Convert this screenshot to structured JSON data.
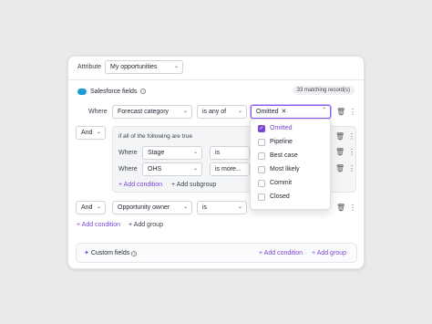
{
  "attribute": {
    "label": "Attribute",
    "value": "My opportunities"
  },
  "salesforce": {
    "title": "Salesforce fields",
    "matching": "33 matching record(s)"
  },
  "row1": {
    "where": "Where",
    "field": "Forecast category",
    "operator": "is any of",
    "chip": "Omitted"
  },
  "group": {
    "joiner": "And",
    "heading": "if all of the following are true",
    "rows": [
      {
        "where": "Where",
        "field": "Stage",
        "operator": "is"
      },
      {
        "where": "Where",
        "field": "OHS",
        "operator": "is more..."
      }
    ],
    "add_condition": "Add condition",
    "add_subgroup": "Add subgroup"
  },
  "row3": {
    "joiner": "And",
    "field": "Opportunity owner",
    "operator": "is"
  },
  "actions": {
    "add_condition": "Add condition",
    "add_group": "Add group"
  },
  "custom": {
    "title": "Custom fields",
    "add_condition": "Add condition",
    "add_group": "Add group"
  },
  "dropdown": {
    "options": [
      {
        "label": "Omitted",
        "checked": true
      },
      {
        "label": "Pipeline",
        "checked": false
      },
      {
        "label": "Best case",
        "checked": false
      },
      {
        "label": "Most likely",
        "checked": false
      },
      {
        "label": "Commit",
        "checked": false
      },
      {
        "label": "Closed",
        "checked": false
      }
    ]
  },
  "colors": {
    "accent": "#7a45d6",
    "salesforce_blue": "#1e9bd7"
  },
  "icons": {
    "chevron": "chevron-down-icon",
    "trash": "trash-icon",
    "drag": "drag-handle-icon",
    "plus": "plus-icon",
    "sparkle": "sparkle-icon",
    "info": "info-icon",
    "check": "check-icon",
    "close": "close-icon"
  }
}
